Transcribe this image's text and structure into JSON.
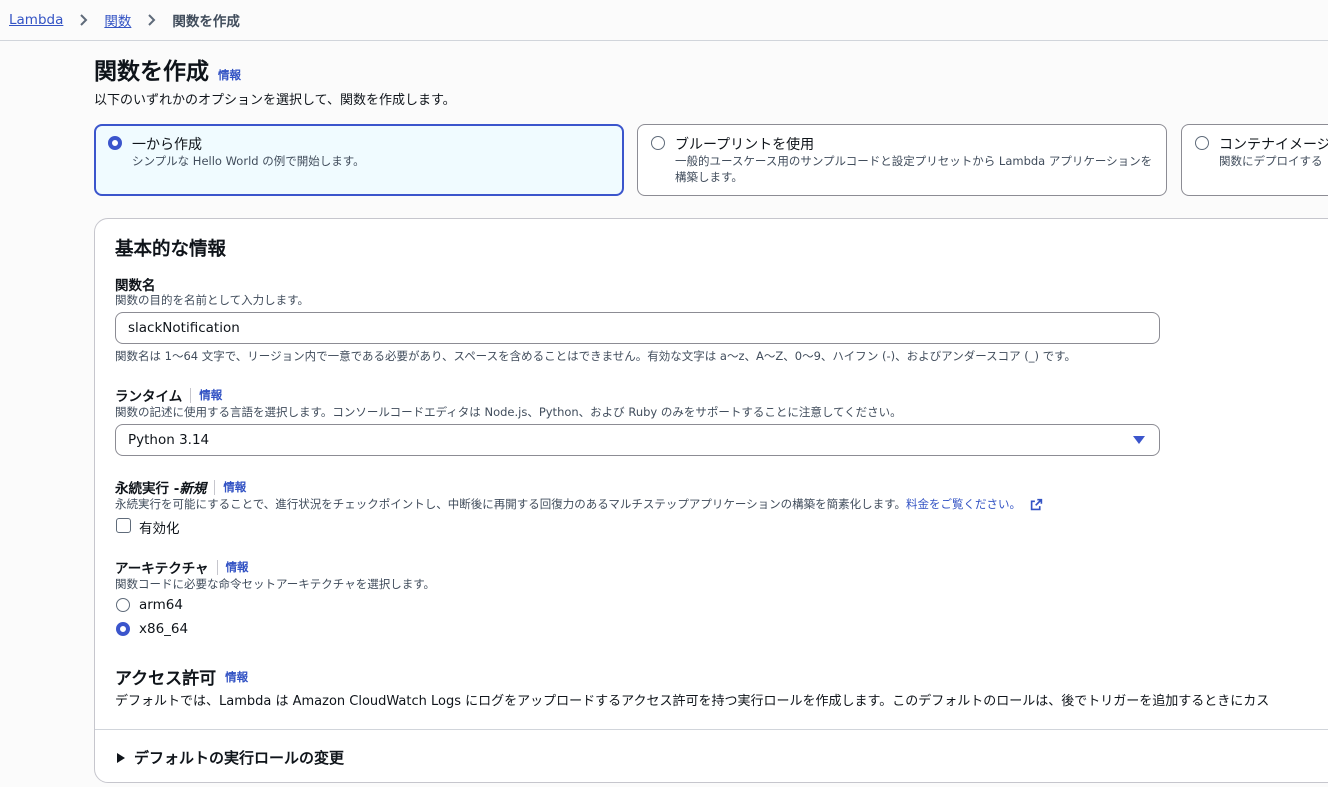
{
  "breadcrumb": {
    "lambda": "Lambda",
    "functions": "関数",
    "current": "関数を作成"
  },
  "header": {
    "title": "関数を作成",
    "info": "情報",
    "description": "以下のいずれかのオプションを選択して、関数を作成します。"
  },
  "options": [
    {
      "title": "一から作成",
      "description": "シンプルな Hello World の例で開始します。"
    },
    {
      "title": "ブループリントを使用",
      "description": "一般的ユースケース用のサンプルコードと設定プリセットから Lambda アプリケーションを構築します。"
    },
    {
      "title": "コンテナイメージ",
      "description": "関数にデプロイする"
    }
  ],
  "basic": {
    "title": "基本的な情報",
    "function_name": {
      "label": "関数名",
      "description": "関数の目的を名前として入力します。",
      "value": "slackNotification",
      "constraint": "関数名は 1〜64 文字で、リージョン内で一意である必要があり、スペースを含めることはできません。有効な文字は a〜z、A〜Z、0〜9、ハイフン (-)、およびアンダースコア (_) です。"
    },
    "runtime": {
      "label": "ランタイム",
      "info": "情報",
      "description": "関数の記述に使用する言語を選択します。コンソールコードエディタは Node.js、Python、および Ruby のみをサポートすることに注意してください。",
      "value": "Python 3.14"
    },
    "durable": {
      "label": "永続実行 - ",
      "label_new": "新規",
      "info": "情報",
      "description": "永続実行を可能にすることで、進行状況をチェックポイントし、中断後に再開する回復力のあるマルチステップアプリケーションの構築を簡素化します。",
      "link": "料金をご覧ください。",
      "checkbox_label": "有効化"
    },
    "architecture": {
      "label": "アーキテクチャ",
      "info": "情報",
      "description": "関数コードに必要な命令セットアーキテクチャを選択します。",
      "options": [
        "arm64",
        "x86_64"
      ]
    },
    "permissions": {
      "title": "アクセス許可",
      "info": "情報",
      "description": "デフォルトでは、Lambda は Amazon CloudWatch Logs にログをアップロードするアクセス許可を持つ実行ロールを作成します。このデフォルトのロールは、後でトリガーを追加するときにカス"
    },
    "expander": "デフォルトの実行ロールの変更"
  },
  "colors": {
    "accent": "#3b55cc",
    "link": "#3353c4"
  }
}
